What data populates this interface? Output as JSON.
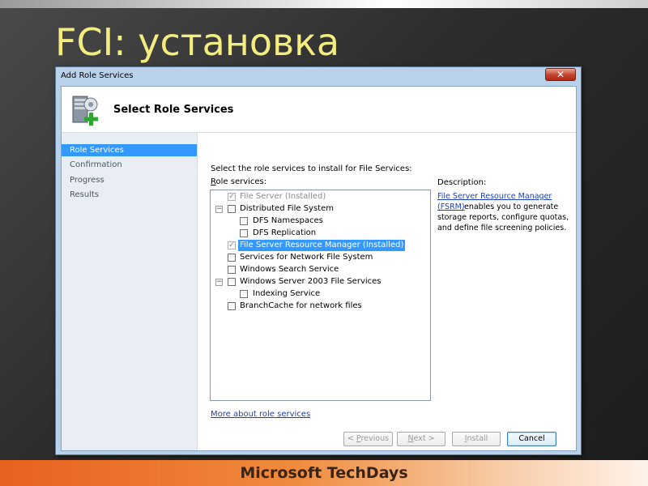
{
  "slide": {
    "title": "FCI: установка",
    "footer": "Microsoft TechDays"
  },
  "window": {
    "title": "Add Role Services",
    "close_glyph": "✕"
  },
  "header": {
    "title": "Select Role Services"
  },
  "nav": {
    "items": [
      {
        "label": "Role Services",
        "active": true
      },
      {
        "label": "Confirmation",
        "active": false
      },
      {
        "label": "Progress",
        "active": false
      },
      {
        "label": "Results",
        "active": false
      }
    ]
  },
  "main": {
    "instruction": "Select the role services to install for File Services:",
    "role_services_label_first": "R",
    "role_services_label_rest": "ole services:",
    "tree": [
      {
        "label": "File Server  (Installed)",
        "checked": true,
        "disabled": true
      },
      {
        "label": "Distributed File System",
        "checked": false,
        "expander": "−"
      },
      {
        "label": "DFS Namespaces",
        "checked": false
      },
      {
        "label": "DFS Replication",
        "checked": false
      },
      {
        "label": "File Server Resource Manager  (Installed)",
        "checked": true,
        "disabled": true,
        "selected": true
      },
      {
        "label": "Services for Network File System",
        "checked": false
      },
      {
        "label": "Windows Search Service",
        "checked": false
      },
      {
        "label": "Windows Server 2003 File Services",
        "checked": false,
        "expander": "−"
      },
      {
        "label": "Indexing Service",
        "checked": false
      },
      {
        "label": "BranchCache for network files",
        "checked": false
      }
    ],
    "more_link": "More about role services"
  },
  "description": {
    "heading": "Description:",
    "link_line1": "File Server Resource Manager",
    "link_line2": "(FSRM)",
    "text_line1": " enables you to generate",
    "text_line2": "storage reports, configure quotas,",
    "text_line3": "and define file screening policies."
  },
  "buttons": {
    "previous_prefix": "< ",
    "previous_u": "P",
    "previous_rest": "revious",
    "next_u": "N",
    "next_rest": "ext >",
    "install_u": "I",
    "install_rest": "nstall",
    "cancel": "Cancel"
  },
  "colors": {
    "title_yellow": "#f3ec7e",
    "selection_blue": "#3399ff",
    "link_blue": "#1b3fb5"
  }
}
